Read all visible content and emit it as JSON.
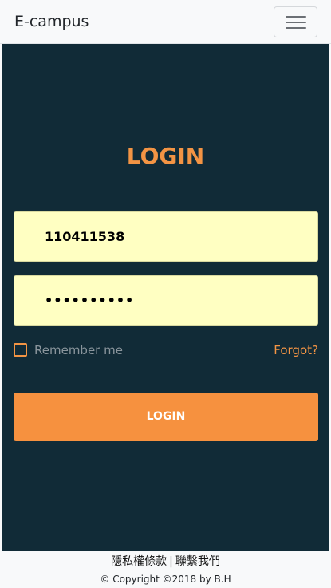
{
  "navbar": {
    "brand": "E-campus",
    "toggler_icon": "hamburger-menu-icon"
  },
  "login": {
    "title": "LOGIN",
    "username_value": "110411538",
    "password_value": "••••••••••",
    "remember_label": "Remember me",
    "remember_checked": false,
    "forgot_label": "Forgot?",
    "submit_label": "LOGIN"
  },
  "footer": {
    "privacy_link": "隱私權條款",
    "separator": "|",
    "contact_link": "聯繫我們",
    "copyright": "© Copyright ©2018 by B.H"
  },
  "colors": {
    "background": "#112b37",
    "accent": "#f39444",
    "input_fill": "#ffffc2",
    "navbar": "#f8f9fa"
  }
}
